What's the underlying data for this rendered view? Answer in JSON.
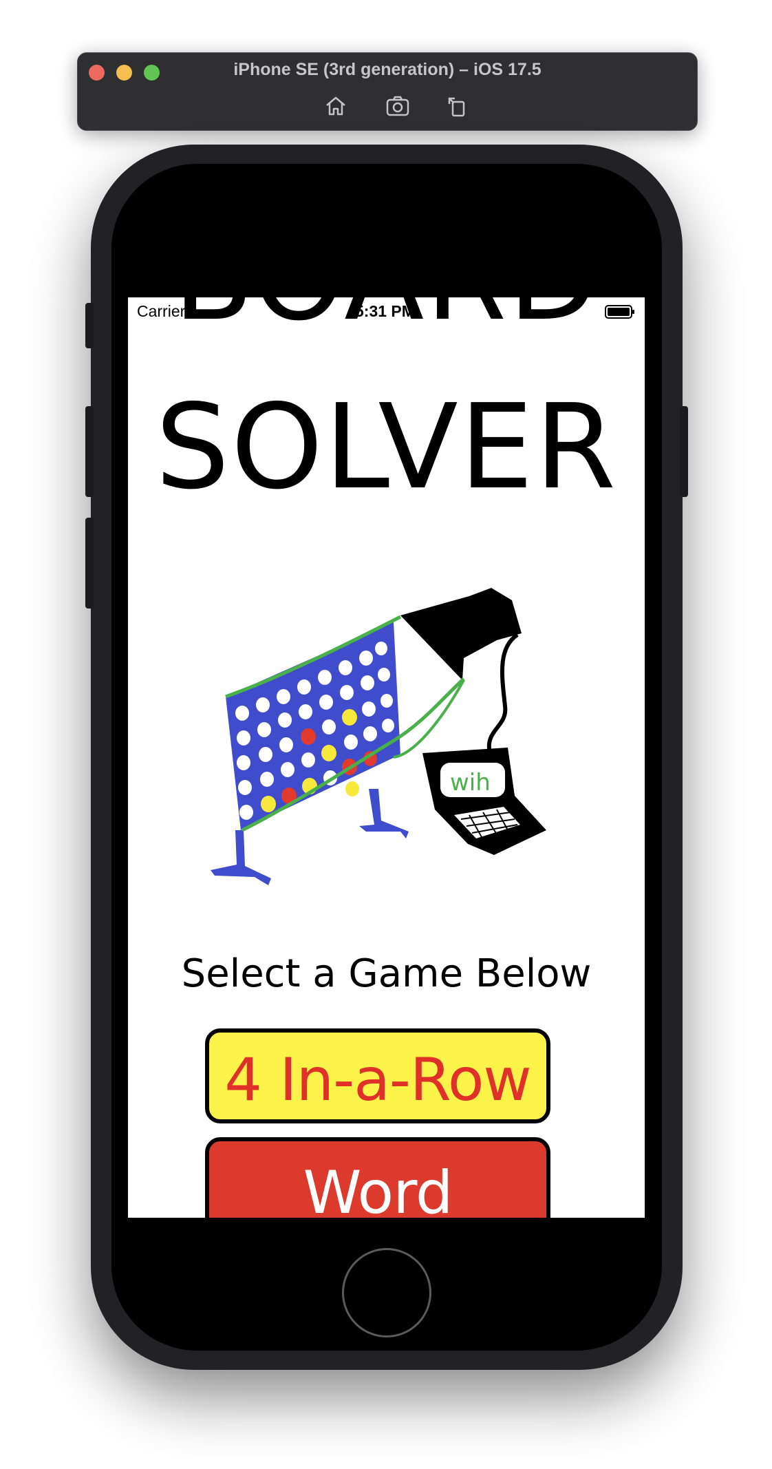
{
  "simulator": {
    "title": "iPhone SE (3rd generation) – iOS 17.5",
    "toolbar": [
      {
        "icon": "home-icon"
      },
      {
        "icon": "screenshot-icon"
      },
      {
        "icon": "rotate-icon"
      }
    ]
  },
  "status_bar": {
    "carrier": "Carrier",
    "time": "5:31 PM",
    "battery_icon": "battery-icon"
  },
  "app": {
    "title_line1": "BOARD",
    "title_line2": "SOLVER",
    "illustration": "board-solver-illustration",
    "subtitle": "Select a Game Below",
    "games": [
      {
        "label": "4 In-a-Row",
        "bg_color": "#fbf349",
        "text_color": "#e0302a"
      },
      {
        "label": "Word Scramble",
        "bg_color": "#dd3a2e",
        "text_color": "#ffffff"
      }
    ]
  },
  "illustration_text": "wih"
}
